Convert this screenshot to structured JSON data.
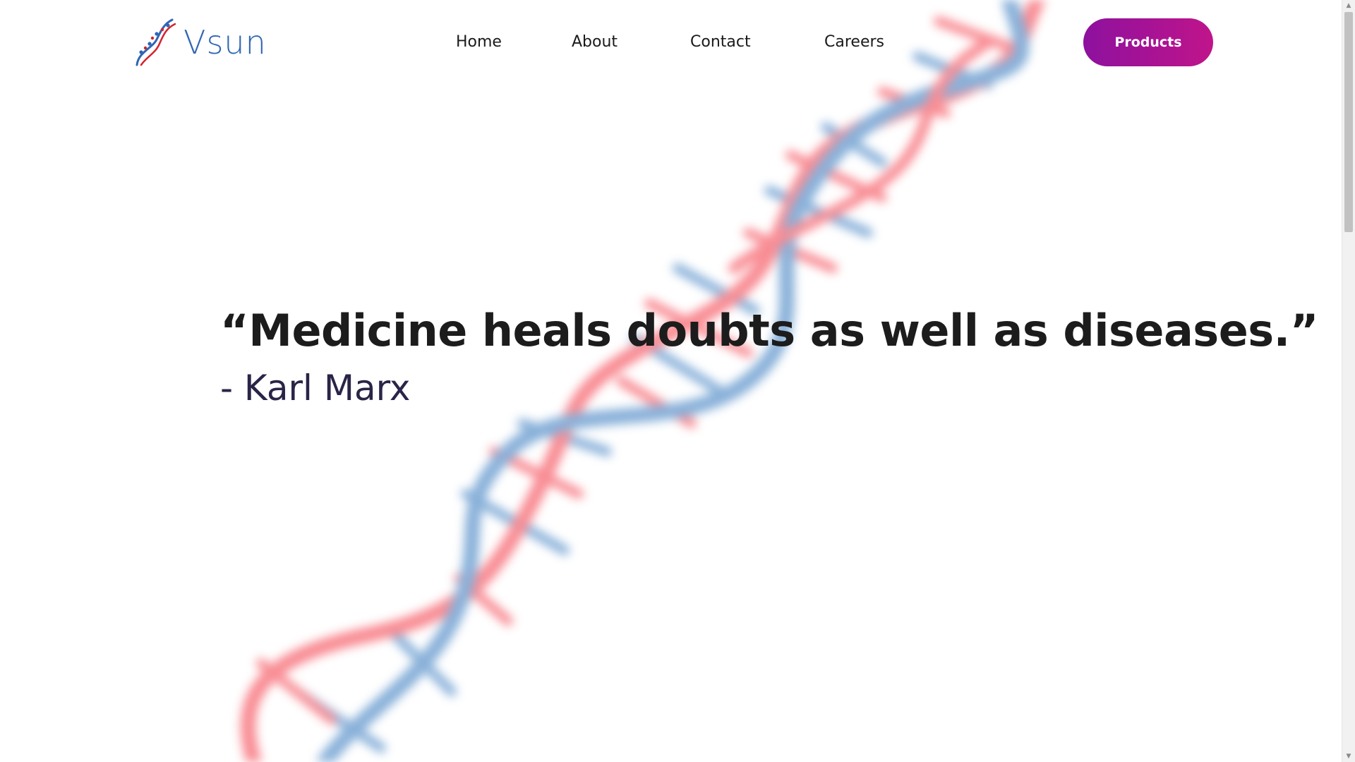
{
  "brand": {
    "name": "Vsun",
    "logo_icon": "dna-helix-icon",
    "logo_color": "#2f66b4"
  },
  "nav": {
    "items": [
      {
        "label": "Home"
      },
      {
        "label": "About"
      },
      {
        "label": "Contact"
      },
      {
        "label": "Careers"
      }
    ],
    "cta_label": "Products",
    "cta_gradient": [
      "#8d119e",
      "#c0148b"
    ]
  },
  "hero": {
    "quote": "“Medicine heals doubts as well as diseases.”",
    "author": "- Karl Marx"
  },
  "background": {
    "icon": "dna-helix-background",
    "colors": {
      "red_strand": "#f4424e",
      "blue_strand": "#3b7dc0"
    }
  },
  "scrollbar": {
    "up_icon": "▲",
    "down_icon": "▼"
  }
}
